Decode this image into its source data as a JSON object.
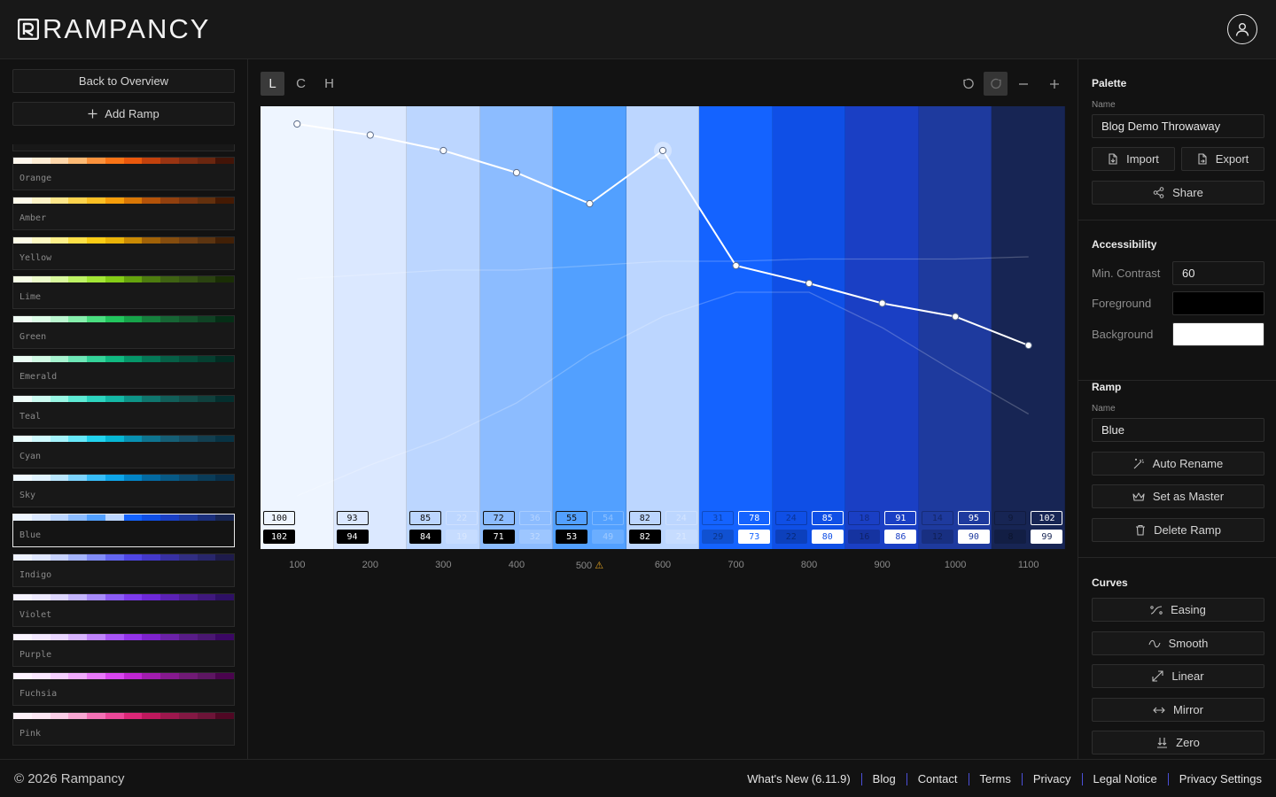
{
  "app": {
    "brand": "RAMPANCY"
  },
  "sidebar": {
    "back_label": "Back to Overview",
    "add_label": "Add Ramp",
    "ramps": [
      {
        "name": "Orange",
        "colors": [
          "#fff7ed",
          "#ffedd5",
          "#fed7aa",
          "#fdba74",
          "#fb923c",
          "#f97316",
          "#ea580c",
          "#c2410c",
          "#9a3412",
          "#7c2d12",
          "#6a260f",
          "#431407"
        ]
      },
      {
        "name": "Amber",
        "colors": [
          "#fffbeb",
          "#fef3c7",
          "#fde68a",
          "#fcd34d",
          "#fbbf24",
          "#f59e0b",
          "#d97706",
          "#b45309",
          "#92400e",
          "#78350f",
          "#63300d",
          "#451a03"
        ]
      },
      {
        "name": "Yellow",
        "colors": [
          "#fefce8",
          "#fef9c3",
          "#fef08a",
          "#fde047",
          "#facc15",
          "#eab308",
          "#ca8a04",
          "#a16207",
          "#854d0e",
          "#713f12",
          "#5c3410",
          "#422006"
        ]
      },
      {
        "name": "Lime",
        "colors": [
          "#f7fee7",
          "#ecfccb",
          "#d9f99d",
          "#bef264",
          "#a3e635",
          "#84cc16",
          "#65a30d",
          "#4d7c0f",
          "#3f6212",
          "#365314",
          "#2a4210",
          "#1a2e05"
        ]
      },
      {
        "name": "Green",
        "colors": [
          "#f0fdf4",
          "#dcfce7",
          "#bbf7d0",
          "#86efac",
          "#4ade80",
          "#22c55e",
          "#16a34a",
          "#15803d",
          "#166534",
          "#14532d",
          "#0f4224",
          "#052e16"
        ]
      },
      {
        "name": "Emerald",
        "colors": [
          "#ecfdf5",
          "#d1fae5",
          "#a7f3d0",
          "#6ee7b7",
          "#34d399",
          "#10b981",
          "#059669",
          "#047857",
          "#065f46",
          "#064e3b",
          "#053f30",
          "#022c22"
        ]
      },
      {
        "name": "Teal",
        "colors": [
          "#f0fdfa",
          "#ccfbf1",
          "#99f6e4",
          "#5eead4",
          "#2dd4bf",
          "#14b8a6",
          "#0d9488",
          "#0f766e",
          "#115e59",
          "#134e4a",
          "#0f403d",
          "#042f2e"
        ]
      },
      {
        "name": "Cyan",
        "colors": [
          "#ecfeff",
          "#cffafe",
          "#a5f3fc",
          "#67e8f9",
          "#22d3ee",
          "#06b6d4",
          "#0891b2",
          "#0e7490",
          "#155e75",
          "#164e63",
          "#123f50",
          "#083344"
        ]
      },
      {
        "name": "Sky",
        "colors": [
          "#f0f9ff",
          "#e0f2fe",
          "#bae6fd",
          "#7dd3fc",
          "#38bdf8",
          "#0ea5e9",
          "#0284c7",
          "#0369a1",
          "#075985",
          "#0c4a6e",
          "#0a3c59",
          "#082f49"
        ]
      },
      {
        "name": "Blue",
        "colors": [
          "#eef5ff",
          "#dbe8ff",
          "#bcd6ff",
          "#8cbcff",
          "#52a0ff",
          "#bcd6ff",
          "#1463ff",
          "#0f4fe6",
          "#1a3fc4",
          "#1e3a9e",
          "#1b2f7c",
          "#172554"
        ],
        "active": true
      },
      {
        "name": "Indigo",
        "colors": [
          "#eef2ff",
          "#e0e7ff",
          "#c7d2fe",
          "#a5b4fc",
          "#818cf8",
          "#6366f1",
          "#4f46e5",
          "#4338ca",
          "#3730a3",
          "#312e81",
          "#28266b",
          "#1e1b4b"
        ]
      },
      {
        "name": "Violet",
        "colors": [
          "#f5f3ff",
          "#ede9fe",
          "#ddd6fe",
          "#c4b5fd",
          "#a78bfa",
          "#8b5cf6",
          "#7c3aed",
          "#6d28d9",
          "#5b21b6",
          "#4c1d95",
          "#3f187c",
          "#2e1065"
        ]
      },
      {
        "name": "Purple",
        "colors": [
          "#faf5ff",
          "#f3e8ff",
          "#e9d5ff",
          "#d8b4fe",
          "#c084fc",
          "#a855f7",
          "#9333ea",
          "#7e22ce",
          "#6b21a8",
          "#581c87",
          "#4a1771",
          "#3b0764"
        ]
      },
      {
        "name": "Fuchsia",
        "colors": [
          "#fdf4ff",
          "#fae8ff",
          "#f5d0fe",
          "#f0abfc",
          "#e879f9",
          "#d946ef",
          "#c026d3",
          "#a21caf",
          "#86198f",
          "#701a75",
          "#5d1662",
          "#4a044e"
        ]
      },
      {
        "name": "Pink",
        "colors": [
          "#fdf2f8",
          "#fce7f3",
          "#fbcfe8",
          "#f9a8d4",
          "#f472b6",
          "#ec4899",
          "#db2777",
          "#be185d",
          "#9d174d",
          "#831843",
          "#6d1438",
          "#500724"
        ]
      }
    ]
  },
  "editor": {
    "axes": [
      "L",
      "C",
      "H"
    ],
    "active_axis": "L",
    "tools": [
      "undo-icon",
      "redo-icon",
      "minus-icon",
      "plus-icon"
    ],
    "steps": [
      {
        "label": "100",
        "color": "#eef5ff",
        "top": "100",
        "bottom": "102",
        "top_ghost": "",
        "bottom_ghost": "",
        "dark_text": true
      },
      {
        "label": "200",
        "color": "#dbe8ff",
        "top": "93",
        "bottom": "94",
        "top_ghost": "",
        "bottom_ghost": "",
        "dark_text": true
      },
      {
        "label": "300",
        "color": "#bcd6ff",
        "top": "85",
        "bottom": "84",
        "top_ghost": "22",
        "bottom_ghost": "19",
        "dark_text": true
      },
      {
        "label": "400",
        "color": "#8cbcff",
        "top": "72",
        "bottom": "71",
        "top_ghost": "36",
        "bottom_ghost": "32",
        "dark_text": true
      },
      {
        "label": "500",
        "color": "#52a0ff",
        "top": "55",
        "bottom": "53",
        "top_ghost": "54",
        "bottom_ghost": "49",
        "dark_text": true,
        "warning": true
      },
      {
        "label": "600",
        "color": "#bcd6ff",
        "top": "82",
        "bottom": "82",
        "top_ghost": "24",
        "bottom_ghost": "21",
        "dark_text": true
      },
      {
        "label": "700",
        "color": "#1463ff",
        "top": "31",
        "bottom": "29",
        "top_ghost": "78",
        "bottom_ghost": "73",
        "dark_text": false
      },
      {
        "label": "800",
        "color": "#0f4fe6",
        "top": "24",
        "bottom": "22",
        "top_ghost": "85",
        "bottom_ghost": "80",
        "dark_text": false
      },
      {
        "label": "900",
        "color": "#1a3fc4",
        "top": "18",
        "bottom": "16",
        "top_ghost": "91",
        "bottom_ghost": "86",
        "dark_text": false
      },
      {
        "label": "1000",
        "color": "#1e3a9e",
        "top": "14",
        "bottom": "12",
        "top_ghost": "95",
        "bottom_ghost": "90",
        "dark_text": false
      },
      {
        "label": "1100",
        "color": "#172554",
        "top": "9",
        "bottom": "8",
        "top_ghost": "102",
        "bottom_ghost": "99",
        "dark_text": false
      }
    ],
    "lightness_curve": [
      96,
      93.5,
      90,
      85,
      78,
      90,
      64,
      60,
      55.5,
      52.5,
      46
    ],
    "chroma_curve": [
      18,
      19,
      20,
      20,
      21,
      22,
      22,
      22.5,
      22.5,
      22.5,
      23
    ],
    "hue_curve": [
      12,
      19,
      25,
      33,
      44,
      52.5,
      58,
      58,
      50,
      40,
      30.5
    ]
  },
  "palette": {
    "title": "Palette",
    "name_label": "Name",
    "name_value": "Blog Demo Throwaway",
    "import_label": "Import",
    "export_label": "Export",
    "share_label": "Share"
  },
  "accessibility": {
    "title": "Accessibility",
    "min_contrast_label": "Min. Contrast",
    "min_contrast_value": "60",
    "foreground_label": "Foreground",
    "foreground_color": "#000000",
    "background_label": "Background",
    "background_color": "#ffffff"
  },
  "ramp": {
    "title": "Ramp",
    "name_label": "Name",
    "name_value": "Blue",
    "auto_rename_label": "Auto Rename",
    "set_master_label": "Set as Master",
    "delete_label": "Delete Ramp"
  },
  "curves": {
    "title": "Curves",
    "items": [
      "Easing",
      "Smooth",
      "Linear",
      "Mirror",
      "Zero"
    ]
  },
  "footer": {
    "copyright": "© 2026 Rampancy",
    "links": [
      "What's New (6.11.9)",
      "Blog",
      "Contact",
      "Terms",
      "Privacy",
      "Legal Notice",
      "Privacy Settings"
    ]
  }
}
